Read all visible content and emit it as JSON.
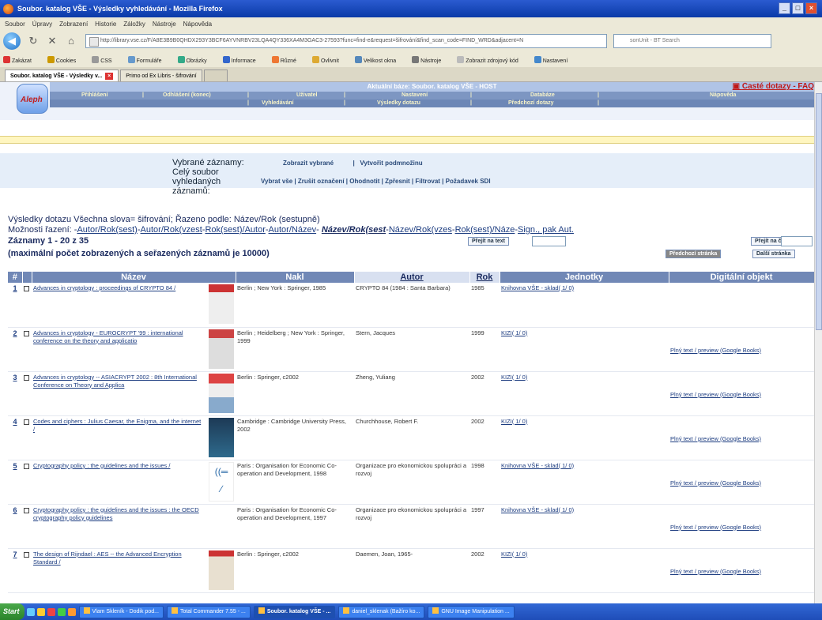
{
  "browser": {
    "title": "Soubor. katalog VŠE - Výsledky vyhledávání - Mozilla Firefox",
    "window_buttons": [
      "_",
      "□",
      "×"
    ],
    "menu": [
      "Soubor",
      "Úpravy",
      "Zobrazení",
      "Historie",
      "Záložky",
      "Nástroje",
      "Nápověda"
    ],
    "url": "http://library.vse.cz/F/A8E3B9B0QHDX293Y3BCF6AYVNRBV23LQA4QY336XA4M3GAC3-27593?func=find-e&request=šifrování&find_scan_code=FIND_WRD&adjacent=N",
    "search_placeholder": "sonUnit - BT Search",
    "bookmarks": [
      "Zakázat",
      "Cookies",
      "CSS",
      "Formuláře",
      "Obrázky",
      "Informace",
      "Různé",
      "Ovlivnit",
      "Velikost okna",
      "Nástroje",
      "Zobrazit zdrojový kód",
      "Nastavení"
    ],
    "tabs": [
      "Soubor. katalog VŠE - Výsledky v...",
      "Primo od Ex Libris - šifrování"
    ]
  },
  "header": {
    "logo_text": "Aleph",
    "base": "Aktuální báze: Soubor. katalog VŠE - HOST",
    "faq": "Časté dotazy - FAQ",
    "nav1": [
      "Přihlášení",
      "Odhlášení (konec)",
      "Uživatel",
      "Nastavení",
      "Databáze",
      "Nápověda"
    ],
    "nav2": [
      "Vyhledávání",
      "Výsledky dotazu",
      "Předchozí dotazy"
    ]
  },
  "selection": {
    "label1": "Vybrané záznamy:",
    "label2": "Celý soubor vyhledaných záznamů:",
    "show_selected": "Zobrazit vybrané",
    "create_subset": "Vytvořit podmnožinu",
    "actions": [
      "Vybrat vše",
      "Zrušit označení",
      "Ohodnotit",
      "Zpřesnit",
      "Filtrovat",
      "Požadavek SDI"
    ]
  },
  "results": {
    "summary": "Výsledky dotazu Všechna slova= šifrování; Řazeno podle: Název/Rok (sestupně)",
    "sort_label": "Možnosti řazení:",
    "sort_options": [
      "Autor/Rok(sest)",
      "Autor/Rok(vzest",
      "Rok(sest)/Autor",
      "Autor/Název",
      "Název/Rok(sest",
      "Název/Rok(vzes",
      "Rok(sest)/Náze",
      "Sign., pak Aut."
    ],
    "sort_current": "Název/Rok(sest",
    "records": "Záznamy 1 - 20 z 35",
    "max_note": "(maximální počet zobrazených a seřazených záznamů je 10000)",
    "jump_text": "Přejít na text",
    "jump_record": "Přejít na č.",
    "prev_page": "Předchozí stránka",
    "next_page": "Další stránka"
  },
  "table": {
    "headers": [
      "#",
      "Název",
      "Nakl",
      "Autor",
      "Rok",
      "Jednotky",
      "Digitální objekt"
    ],
    "rows": [
      {
        "num": "1",
        "title": "Advances in cryptology : proceedings of CRYPTO 84 /",
        "publisher": "Berlin ; New York : Springer, 1985",
        "author": "CRYPTO 84 (1984 : Santa Barbara)",
        "year": "1985",
        "units": "Knihovna VŠE - sklad( 1/ 0)",
        "digital": ""
      },
      {
        "num": "2",
        "title": "Advances in cryptology - EUROCRYPT '99 : international conference on the theory and applicatio",
        "publisher": "Berlin ; Heidelberg ; New York : Springer, 1999",
        "author": "Stern, Jacques",
        "year": "1999",
        "units": "KIZI( 1/ 0)",
        "digital": "Plný text / preview (Google Books)"
      },
      {
        "num": "3",
        "title": "Advances in cryptology -- ASIACRYPT 2002 : 8th International Conference on Theory and Applica",
        "publisher": "Berlin : Springer, c2002",
        "author": "Zheng, Yuliang",
        "year": "2002",
        "units": "KIZI( 1/ 0)",
        "digital": "Plný text / preview (Google Books)"
      },
      {
        "num": "4",
        "title": "Codes and ciphers : Julius Caesar, the Enigma, and the internet /",
        "publisher": "Cambridge : Cambridge University Press, 2002",
        "author": "Churchhouse, Robert F.",
        "year": "2002",
        "units": "KIZI( 1/ 0)",
        "digital": "Plný text / preview (Google Books)"
      },
      {
        "num": "5",
        "title": "Cryptography policy : the guidelines and the issues /",
        "publisher": "Paris : Organisation for Economic Co-operation and Development, 1998",
        "author": "Organizace pro ekonomickou spolupráci a rozvoj",
        "year": "1998",
        "units": "Knihovna VŠE - sklad( 1/ 0)",
        "digital": "Plný text / preview (Google Books)"
      },
      {
        "num": "6",
        "title": "Cryptography policy : the guidelines and the issues : the OECD cryptography policy guidelines",
        "publisher": "Paris : Organisation for Economic Co-operation and Development, 1997",
        "author": "Organizace pro ekonomickou spolupráci a rozvoj",
        "year": "1997",
        "units": "Knihovna VŠE - sklad( 1/ 0)",
        "digital": "Plný text / preview (Google Books)"
      },
      {
        "num": "7",
        "title": "The design of Rijndael : AES -- the Advanced Encryption Standard /",
        "publisher": "Berlin : Springer, c2002",
        "author": "Daemen, Joan, 1965-",
        "year": "2002",
        "units": "KIZI( 1/ 0)",
        "digital": "Plný text / preview (Google Books)"
      }
    ]
  },
  "taskbar": {
    "start": "Start",
    "tasks": [
      "Vlam Skleník - Dodik pod...",
      "Total Commander 7.55 - ...",
      "Soubor. katalog VŠE - ...",
      "daniel_sklenak (Bažíro ko...",
      "GNU Image Manipulation ..."
    ]
  },
  "colors": {
    "header_blue": "#7d96c2",
    "link": "#1c3c80",
    "table_header": "#7188b6"
  }
}
